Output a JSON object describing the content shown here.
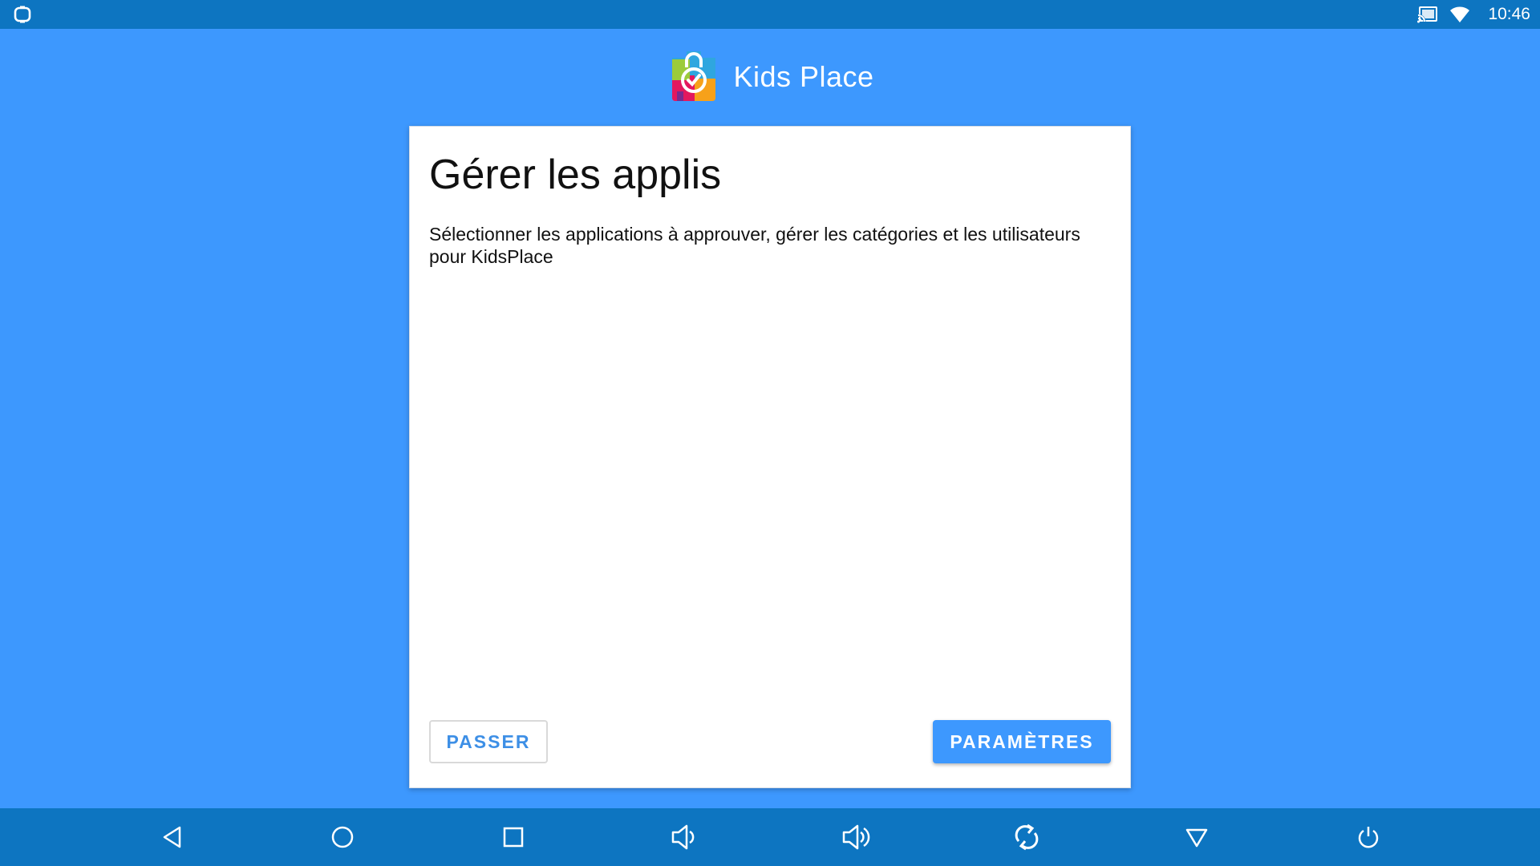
{
  "status_bar": {
    "time": "10:46",
    "left_icon": "app-notification-icon",
    "icons": [
      "cast-icon",
      "wifi-icon"
    ]
  },
  "header": {
    "app_name": "Kids Place",
    "logo": "kids-place-logo"
  },
  "card": {
    "title": "Gérer les applis",
    "description": "Sélectionner les applications à approuver, gérer les catégories et les utilisateurs pour KidsPlace",
    "skip_label": "PASSER",
    "settings_label": "PARAMÈTRES"
  },
  "nav_bar": {
    "icons": [
      "back-icon",
      "home-icon",
      "recents-icon",
      "volume-down-icon",
      "volume-up-icon",
      "rotate-icon",
      "notifications-down-icon",
      "power-icon"
    ]
  },
  "colors": {
    "background": "#3d98fe",
    "system_bars": "#0d75c1",
    "card": "#ffffff",
    "accent": "#3d98fe",
    "skip_text": "#3d8fe6"
  }
}
